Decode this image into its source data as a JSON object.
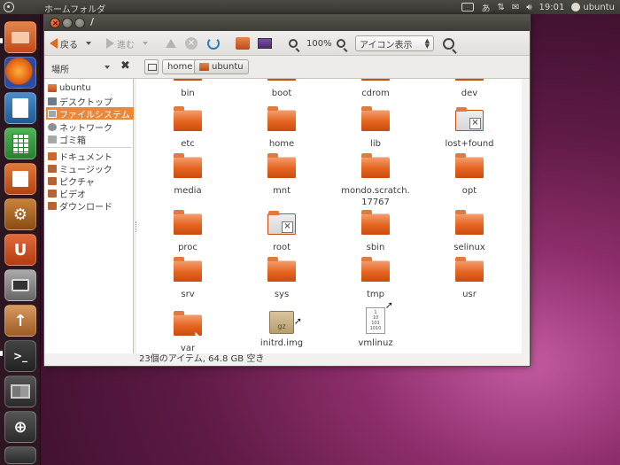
{
  "top_panel": {
    "title": "ホームフォルダ",
    "clock": "19:01",
    "user": "ubuntu"
  },
  "launcher": {
    "items": [
      "home-folder",
      "firefox",
      "libreoffice-writer",
      "libreoffice-calc",
      "libreoffice-impress",
      "software-center",
      "ubuntu-one",
      "cheese-camera",
      "update-manager",
      "terminal",
      "workspace-switcher",
      "zoom",
      "trash"
    ]
  },
  "window": {
    "title": "/",
    "toolbar": {
      "back_label": "戻る",
      "forward_label": "進む",
      "zoom_level": "100%",
      "view_mode": "アイコン表示"
    },
    "locbar": {
      "places_label": "場所",
      "crumbs": [
        "home",
        "ubuntu"
      ]
    },
    "sidebar": {
      "devices": [
        {
          "label": "ubuntu",
          "icon": "home-icon"
        },
        {
          "label": "デスクトップ",
          "icon": "desktop-icon"
        },
        {
          "label": "ファイルシステム",
          "icon": "filesystem-icon",
          "selected": true
        },
        {
          "label": "ネットワーク",
          "icon": "network-icon"
        },
        {
          "label": "ゴミ箱",
          "icon": "trash-icon"
        }
      ],
      "bookmarks": [
        {
          "label": "ドキュメント",
          "icon": "documents-icon"
        },
        {
          "label": "ミュージック",
          "icon": "music-icon"
        },
        {
          "label": "ピクチャ",
          "icon": "pictures-icon"
        },
        {
          "label": "ビデオ",
          "icon": "videos-icon"
        },
        {
          "label": "ダウンロード",
          "icon": "downloads-icon"
        }
      ]
    },
    "files": [
      {
        "name": "bin",
        "type": "folder"
      },
      {
        "name": "boot",
        "type": "folder"
      },
      {
        "name": "cdrom",
        "type": "folder"
      },
      {
        "name": "dev",
        "type": "folder"
      },
      {
        "name": "etc",
        "type": "folder"
      },
      {
        "name": "home",
        "type": "folder"
      },
      {
        "name": "lib",
        "type": "folder"
      },
      {
        "name": "lost+found",
        "type": "folder-locked"
      },
      {
        "name": "media",
        "type": "folder"
      },
      {
        "name": "mnt",
        "type": "folder"
      },
      {
        "name": "mondo.scratch.",
        "name2": "17767",
        "type": "folder"
      },
      {
        "name": "opt",
        "type": "folder"
      },
      {
        "name": "proc",
        "type": "folder"
      },
      {
        "name": "root",
        "type": "folder-locked"
      },
      {
        "name": "sbin",
        "type": "folder"
      },
      {
        "name": "selinux",
        "type": "folder"
      },
      {
        "name": "srv",
        "type": "folder"
      },
      {
        "name": "sys",
        "type": "folder"
      },
      {
        "name": "tmp",
        "type": "folder"
      },
      {
        "name": "usr",
        "type": "folder"
      },
      {
        "name": "var",
        "type": "folder"
      },
      {
        "name": "initrd.img",
        "type": "archive-link",
        "badge": "gz"
      },
      {
        "name": "vmlinuz",
        "type": "binary-link",
        "bits": [
          "1",
          "10",
          "101",
          "1010"
        ]
      }
    ],
    "status": "23個のアイテム, 64.8 GB 空き"
  }
}
